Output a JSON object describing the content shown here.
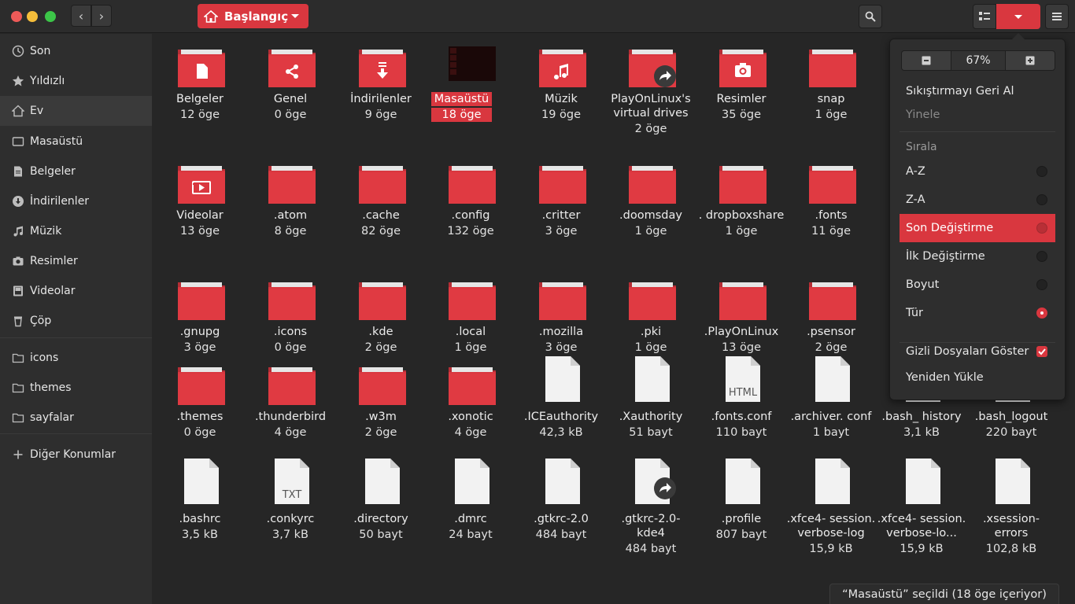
{
  "header": {
    "path_label": "Başlangıç",
    "zoom_level": "67%"
  },
  "sidebar": {
    "items": [
      {
        "label": "Son",
        "icon": "clock-icon"
      },
      {
        "label": "Yıldızlı",
        "icon": "star-icon"
      },
      {
        "label": "Ev",
        "icon": "home-icon",
        "active": true
      },
      {
        "label": "Masaüstü",
        "icon": "desktop-icon"
      },
      {
        "label": "Belgeler",
        "icon": "document-icon"
      },
      {
        "label": "İndirilenler",
        "icon": "download-icon"
      },
      {
        "label": "Müzik",
        "icon": "music-icon"
      },
      {
        "label": "Resimler",
        "icon": "camera-icon"
      },
      {
        "label": "Videolar",
        "icon": "video-icon"
      },
      {
        "label": "Çöp",
        "icon": "trash-icon"
      },
      {
        "label": "icons",
        "icon": "folder-icon"
      },
      {
        "label": "themes",
        "icon": "folder-icon"
      },
      {
        "label": "sayfalar",
        "icon": "folder-icon"
      },
      {
        "label": "Diğer Konumlar",
        "icon": "plus-icon"
      }
    ]
  },
  "files": [
    {
      "name": "Belgeler",
      "meta": "12 öge",
      "kind": "folder",
      "emblem": "document"
    },
    {
      "name": "Genel",
      "meta": "0 öge",
      "kind": "folder",
      "emblem": "share"
    },
    {
      "name": "İndirilenler",
      "meta": "9 öge",
      "kind": "folder",
      "emblem": "download"
    },
    {
      "name": "Masaüstü",
      "meta": "18 öge",
      "kind": "desktop",
      "selected": true
    },
    {
      "name": "Müzik",
      "meta": "19 öge",
      "kind": "folder",
      "emblem": "music"
    },
    {
      "name": "PlayOnLinux's virtual drives",
      "meta": "2 öge",
      "kind": "folder",
      "emblem": "link"
    },
    {
      "name": "Resimler",
      "meta": "35 öge",
      "kind": "folder",
      "emblem": "camera"
    },
    {
      "name": "snap",
      "meta": "1 öge",
      "kind": "folder"
    },
    {
      "name": "Videolar",
      "meta": "13 öge",
      "kind": "folder",
      "emblem": "video"
    },
    {
      "name": ".atom",
      "meta": "8 öge",
      "kind": "folder"
    },
    {
      "name": ".cache",
      "meta": "82 öge",
      "kind": "folder"
    },
    {
      "name": ".config",
      "meta": "132 öge",
      "kind": "folder"
    },
    {
      "name": ".critter",
      "meta": "3 öge",
      "kind": "folder"
    },
    {
      "name": ".doomsday",
      "meta": "1 öge",
      "kind": "folder"
    },
    {
      "name": ". dropboxshare",
      "meta": "1 öge",
      "kind": "folder"
    },
    {
      "name": ".fonts",
      "meta": "11 öge",
      "kind": "folder"
    },
    {
      "name": ".gnupg",
      "meta": "3 öge",
      "kind": "folder"
    },
    {
      "name": ".icons",
      "meta": "0 öge",
      "kind": "folder"
    },
    {
      "name": ".kde",
      "meta": "2 öge",
      "kind": "folder"
    },
    {
      "name": ".local",
      "meta": "1 öge",
      "kind": "folder"
    },
    {
      "name": ".mozilla",
      "meta": "3 öge",
      "kind": "folder"
    },
    {
      "name": ".pki",
      "meta": "1 öge",
      "kind": "folder"
    },
    {
      "name": ".PlayOnLinux",
      "meta": "13 öge",
      "kind": "folder"
    },
    {
      "name": ".psensor",
      "meta": "2 öge",
      "kind": "folder"
    },
    {
      "name": ".themes",
      "meta": "0 öge",
      "kind": "folder"
    },
    {
      "name": ".thunderbird",
      "meta": "4 öge",
      "kind": "folder"
    },
    {
      "name": ".w3m",
      "meta": "2 öge",
      "kind": "folder"
    },
    {
      "name": ".xonotic",
      "meta": "4 öge",
      "kind": "folder"
    },
    {
      "name": ".ICEauthority",
      "meta": "42,3 kB",
      "kind": "file"
    },
    {
      "name": ".Xauthority",
      "meta": "51 bayt",
      "kind": "file"
    },
    {
      "name": ".fonts.conf",
      "meta": "110 bayt",
      "kind": "file",
      "label": "HTML"
    },
    {
      "name": ".archiver. conf",
      "meta": "1 bayt",
      "kind": "file"
    },
    {
      "name": ".bash_ history",
      "meta": "3,1 kB",
      "kind": "file"
    },
    {
      "name": ".bash_logout",
      "meta": "220 bayt",
      "kind": "file"
    },
    {
      "name": ".bashrc",
      "meta": "3,5 kB",
      "kind": "file"
    },
    {
      "name": ".conkyrc",
      "meta": "3,7 kB",
      "kind": "file",
      "label": "TXT"
    },
    {
      "name": ".directory",
      "meta": "50 bayt",
      "kind": "file"
    },
    {
      "name": ".dmrc",
      "meta": "24 bayt",
      "kind": "file"
    },
    {
      "name": ".gtkrc-2.0",
      "meta": "484 bayt",
      "kind": "file"
    },
    {
      "name": ".gtkrc-2.0- kde4",
      "meta": "484 bayt",
      "kind": "file",
      "emblem": "link"
    },
    {
      "name": ".profile",
      "meta": "807 bayt",
      "kind": "file"
    },
    {
      "name": ".xfce4- session. verbose-log",
      "meta": "15,9 kB",
      "kind": "file"
    },
    {
      "name": ".xfce4- session. verbose-lo...",
      "meta": "15,9 kB",
      "kind": "file"
    },
    {
      "name": ".xsession- errors",
      "meta": "102,8 kB",
      "kind": "file"
    }
  ],
  "popover": {
    "undo_label": "Sıkıştırmayı Geri Al",
    "redo_label": "Yinele",
    "sort_section": "Sırala",
    "sort_options": [
      {
        "label": "A-Z"
      },
      {
        "label": "Z-A"
      },
      {
        "label": "Son Değiştirme",
        "active": true
      },
      {
        "label": "İlk Değiştirme"
      },
      {
        "label": "Boyut"
      },
      {
        "label": "Tür",
        "checked": true
      }
    ],
    "show_hidden_label": "Gizli Dosyaları Göster",
    "reload_label": "Yeniden Yükle"
  },
  "status": "“Masaüstü” seçildi (18 öge içeriyor)",
  "colors": {
    "accent": "#d9373f",
    "background": "#262626",
    "sidebar": "#2e2e2e"
  }
}
